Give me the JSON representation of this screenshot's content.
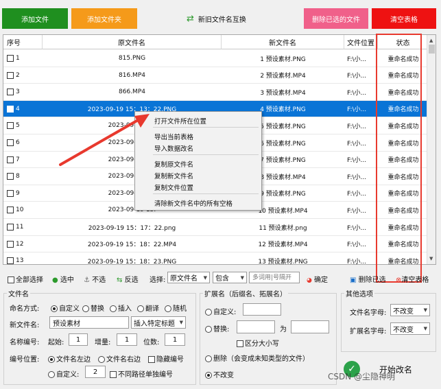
{
  "toolbar": {
    "add_file": "添加文件",
    "add_folder": "添加文件夹",
    "swap_names": "新旧文件名互换",
    "delete_selected": "删除已选的文件",
    "clear_table": "清空表格"
  },
  "colors": {
    "add_file": "#1f8f1f",
    "add_folder": "#f59a1a",
    "delete_selected": "#f0608a",
    "clear_table": "#ee1212",
    "selected_row": "#0a74d6",
    "annotation": "#e8392e"
  },
  "table": {
    "headers": {
      "index": "序号",
      "original": "原文件名",
      "new": "新文件名",
      "location": "文件位置",
      "status": "状态"
    },
    "rows": [
      {
        "index": "1",
        "original": "815.PNG",
        "new": "1 预设素材.PNG",
        "location": "F:\\小...",
        "status": "重命名成功"
      },
      {
        "index": "2",
        "original": "816.MP4",
        "new": "2 预设素材.MP4",
        "location": "F:\\小...",
        "status": "重命名成功"
      },
      {
        "index": "3",
        "original": "866.MP4",
        "new": "3 预设素材.MP4",
        "location": "F:\\小...",
        "status": "重命名成功"
      },
      {
        "index": "4",
        "original": "2023-09-19 15：13：22.PNG",
        "new": "4 预设素材.PNG",
        "location": "F:\\小...",
        "status": "重命名成功"
      },
      {
        "index": "5",
        "original": "2023-09-19 15:",
        "new": "5 预设素材.PNG",
        "location": "F:\\小...",
        "status": "重命名成功"
      },
      {
        "index": "6",
        "original": "2023-09-19 15:",
        "new": "6 预设素材.PNG",
        "location": "F:\\小...",
        "status": "重命名成功"
      },
      {
        "index": "7",
        "original": "2023-09-19 15:",
        "new": "7 预设素材.PNG",
        "location": "F:\\小...",
        "status": "重命名成功"
      },
      {
        "index": "8",
        "original": "2023-09-19 15:",
        "new": "8 预设素材.MP4",
        "location": "F:\\小...",
        "status": "重命名成功"
      },
      {
        "index": "9",
        "original": "2023-09-19 15:",
        "new": "9 预设素材.PNG",
        "location": "F:\\小...",
        "status": "重命名成功"
      },
      {
        "index": "10",
        "original": "2023-09-19 15:",
        "new": "10 预设素材.MP4",
        "location": "F:\\小...",
        "status": "重命名成功"
      },
      {
        "index": "11",
        "original": "2023-09-19 15：17：22.png",
        "new": "11 预设素材.png",
        "location": "F:\\小...",
        "status": "重命名成功"
      },
      {
        "index": "12",
        "original": "2023-09-19 15：18：22.MP4",
        "new": "12 预设素材.MP4",
        "location": "F:\\小...",
        "status": "重命名成功"
      },
      {
        "index": "13",
        "original": "2023-09-19 15：18：23.PNG",
        "new": "13 预设素材.PNG",
        "location": "F:\\小...",
        "status": "重命名成功"
      }
    ]
  },
  "context_menu": {
    "open_location": "打开文件所在位置",
    "export_table": "导出当前表格",
    "import_rename": "导入数据改名",
    "copy_original": "复制原文件名",
    "copy_new": "复制新文件名",
    "copy_location": "复制文件位置",
    "clear_spaces": "清除新文件名中的所有空格"
  },
  "selection_bar": {
    "select_all": "全部选择",
    "select": "选中",
    "deselect": "不选",
    "invert": "反选",
    "choose_label": "选择:",
    "column_value": "原文件名",
    "match_value": "包含",
    "pattern_placeholder": "多词用|号隔开",
    "confirm": "确定",
    "delete_selected": "删除已选",
    "clear_table": "清空表格"
  },
  "filename_panel": {
    "title": "文件名",
    "mode_label": "命名方式:",
    "modes": [
      "自定义",
      "替换",
      "插入",
      "翻译",
      "随机"
    ],
    "new_name_label": "新文件名:",
    "new_name_value": "预设素材",
    "insert_tag": "插入特定标题",
    "number_label": "名称编号:",
    "start_label": "起始:",
    "start_value": "1",
    "step_label": "增量:",
    "step_value": "1",
    "digits_label": "位数:",
    "digits_value": "1",
    "position_label": "编号位置:",
    "pos_left": "文件名左边",
    "pos_right": "文件名右边",
    "hide_number": "隐藏编号",
    "custom_label": "自定义:",
    "custom_value": "2",
    "separate_paths": "不同路径单独编号"
  },
  "extension_panel": {
    "title": "扩展名（后缀名、拓展名）",
    "custom": "自定义:",
    "replace": "替换:",
    "to": "为",
    "case_sensitive": "区分大小写",
    "delete_note": "删除（会变成未知类型的文件）",
    "no_change": "不改变"
  },
  "other_panel": {
    "title": "其他选项",
    "filename_case_label": "文件名字母:",
    "filename_case_value": "不改变",
    "ext_case_label": "扩展名字母:",
    "ext_case_value": "不改变"
  },
  "start_button": "开始改名",
  "watermark": "CSDN @尘隐神明"
}
